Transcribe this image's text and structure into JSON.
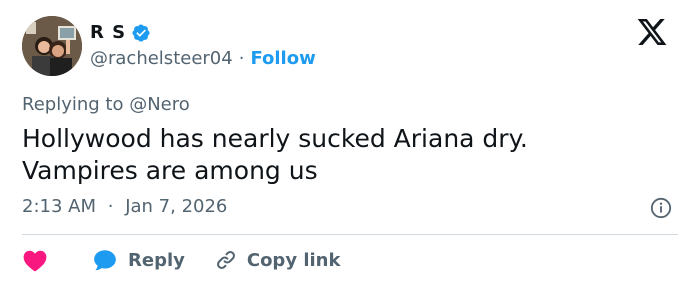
{
  "user": {
    "name": "R S",
    "handle": "@rachelsteer04",
    "follow_label": "Follow",
    "separator": "·"
  },
  "reply_context": {
    "prefix": "Replying to",
    "mention": "@Nero"
  },
  "tweet": {
    "lines": [
      "Hollywood has nearly sucked Ariana dry.",
      "Vampires are among us"
    ]
  },
  "timestamp": {
    "time": "2:13 AM",
    "separator": "·",
    "date": "Jan 7, 2026"
  },
  "actions": {
    "reply_label": "Reply",
    "copy_link_label": "Copy link"
  },
  "colors": {
    "accent": "#1d9bf0",
    "like": "#f91880",
    "muted": "#536471",
    "text": "#0f1419"
  },
  "icons": [
    "verified-badge-icon",
    "x-logo-icon",
    "info-icon",
    "heart-icon",
    "reply-bubble-icon",
    "link-icon"
  ]
}
